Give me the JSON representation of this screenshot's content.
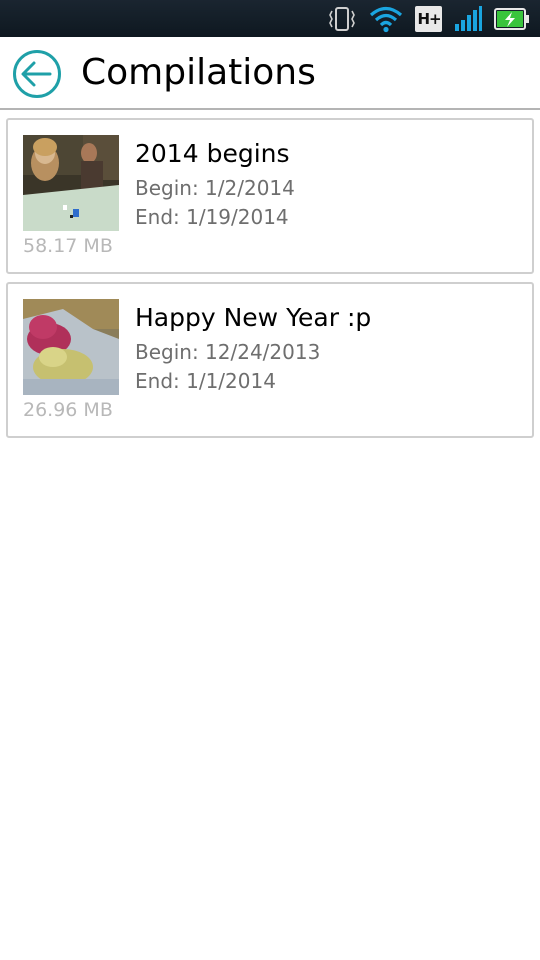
{
  "status_bar": {
    "network_label": "H+",
    "icons": [
      "vibrate-icon",
      "wifi-icon",
      "network-type-icon",
      "signal-icon",
      "battery-charging-icon"
    ]
  },
  "header": {
    "title": "Compilations",
    "back_icon": "arrow-left-circle-icon",
    "accent_color": "#1fa0a8"
  },
  "compilations": [
    {
      "title": "2014 begins",
      "begin": "Begin: 1/2/2014",
      "end": "End: 1/19/2014",
      "size": "58.17 MB",
      "thumbnail": "people-at-table-photo"
    },
    {
      "title": "Happy New Year :p",
      "begin": "Begin: 12/24/2013",
      "end": "End: 1/1/2014",
      "size": "26.96 MB",
      "thumbnail": "baby-sleeping-photo"
    }
  ]
}
